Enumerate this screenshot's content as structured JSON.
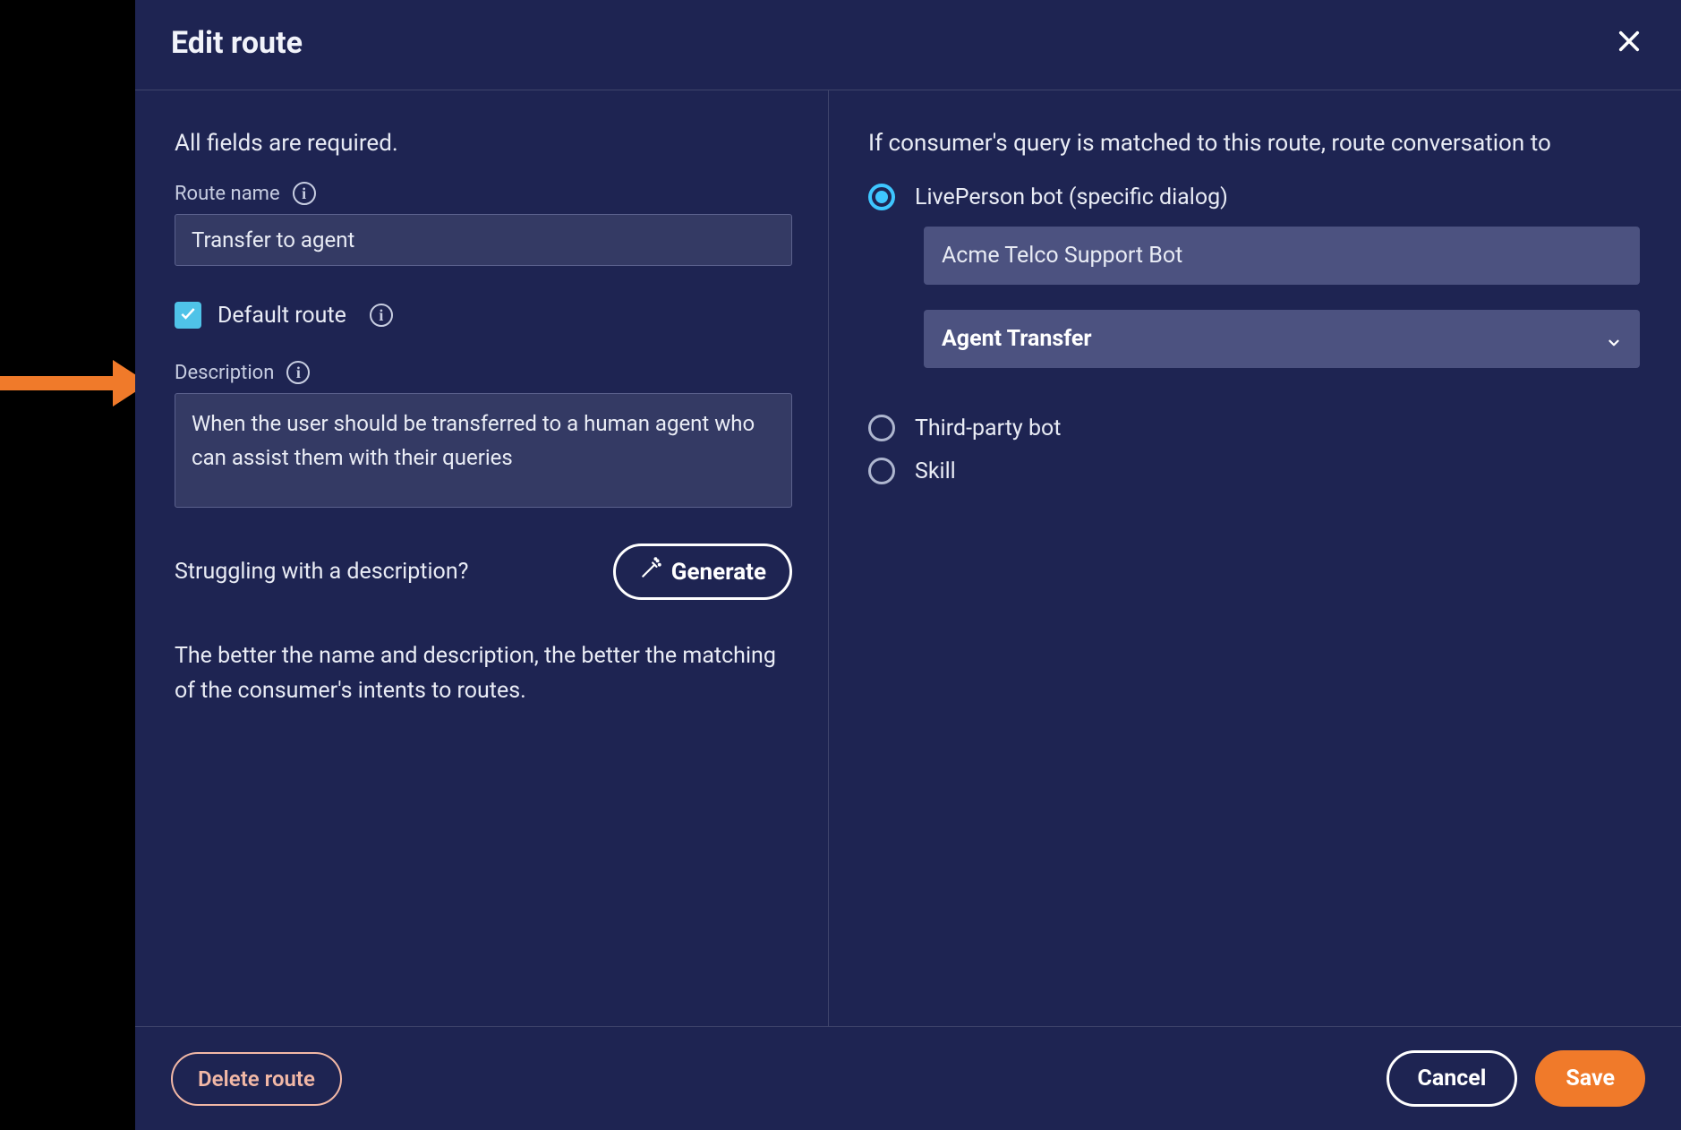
{
  "header": {
    "title": "Edit route"
  },
  "left": {
    "all_required": "All fields are required.",
    "route_name_label": "Route name",
    "route_name_value": "Transfer to agent",
    "default_route_label": "Default route",
    "description_label": "Description",
    "description_value": "When the user should be transferred to a human agent who can assist them with their queries",
    "struggling_text": "Struggling with a description?",
    "generate_label": "Generate",
    "helper_text": "The better the name and description, the better the matching of the consumer's intents to routes."
  },
  "right": {
    "heading": "If consumer's query is matched to this route, route conversation to",
    "options": {
      "liveperson_bot": "LivePerson bot (specific dialog)",
      "third_party": "Third-party bot",
      "skill": "Skill"
    },
    "bot_name": "Acme Telco Support Bot",
    "dialog_selected": "Agent Transfer"
  },
  "footer": {
    "delete": "Delete route",
    "cancel": "Cancel",
    "save": "Save"
  }
}
